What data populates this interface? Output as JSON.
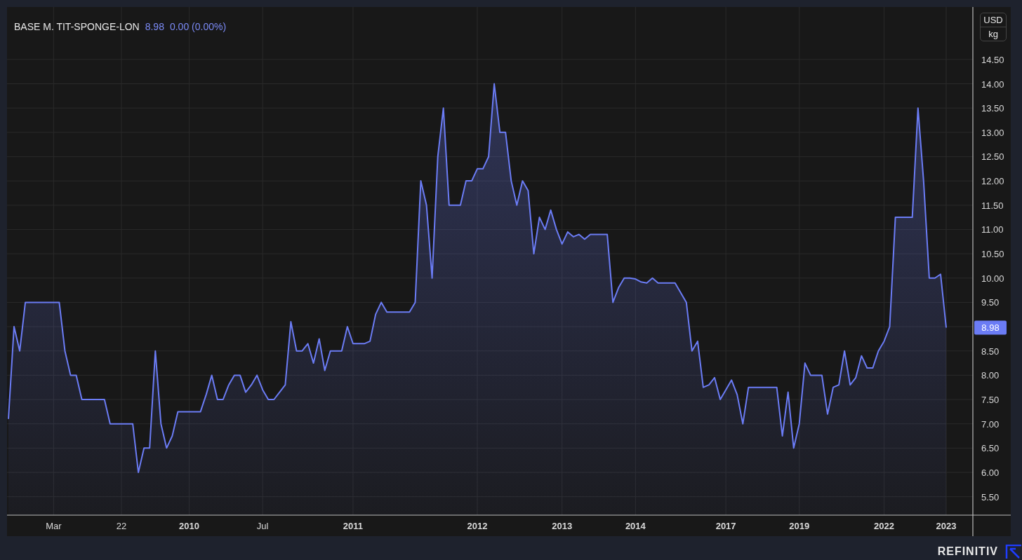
{
  "legend": {
    "last": "8.98",
    "change": "0.00 (0.00%)"
  },
  "units": [
    "USD",
    "kg"
  ],
  "chart": {
    "xtick_bold": [
      false,
      false,
      true,
      false,
      true,
      true,
      true,
      true,
      true,
      true,
      true,
      true
    ],
    "chart_data": {
      "type": "area",
      "grid": true,
      "ylim": [
        5.12,
        15.58
      ],
      "yticks": [
        {
          "value": 5.5,
          "label": "5.50"
        },
        {
          "value": 6,
          "label": "6.00"
        },
        {
          "value": 6.5,
          "label": "6.50"
        },
        {
          "value": 7,
          "label": "7.00"
        },
        {
          "value": 7.5,
          "label": "7.50"
        },
        {
          "value": 8,
          "label": "8.00"
        },
        {
          "value": 8.5,
          "label": "8.50"
        },
        {
          "value": 9.5,
          "label": "9.50"
        },
        {
          "value": 10,
          "label": "10.00"
        },
        {
          "value": 10.5,
          "label": "10.50"
        },
        {
          "value": 11,
          "label": "11.00"
        },
        {
          "value": 11.5,
          "label": "11.50"
        },
        {
          "value": 12,
          "label": "12.00"
        },
        {
          "value": 12.5,
          "label": "12.50"
        },
        {
          "value": 13,
          "label": "13.00"
        },
        {
          "value": 13.5,
          "label": "13.50"
        },
        {
          "value": 14,
          "label": "14.00"
        },
        {
          "value": 14.5,
          "label": "14.50"
        }
      ],
      "categories": [
        null,
        null,
        null,
        null,
        null,
        null,
        null,
        null,
        "Mar",
        null,
        null,
        null,
        null,
        null,
        null,
        null,
        null,
        null,
        null,
        null,
        "22",
        null,
        null,
        null,
        null,
        null,
        null,
        null,
        null,
        null,
        null,
        null,
        "2010",
        null,
        null,
        null,
        null,
        null,
        null,
        null,
        null,
        null,
        null,
        null,
        null,
        "Jul",
        null,
        null,
        null,
        null,
        null,
        null,
        null,
        null,
        null,
        null,
        null,
        null,
        null,
        null,
        null,
        "2011",
        null,
        null,
        null,
        null,
        null,
        null,
        null,
        null,
        null,
        null,
        null,
        null,
        null,
        null,
        null,
        null,
        null,
        null,
        null,
        null,
        null,
        "2012",
        null,
        null,
        null,
        null,
        null,
        null,
        null,
        null,
        null,
        null,
        null,
        null,
        null,
        null,
        "2013",
        null,
        null,
        null,
        null,
        null,
        null,
        null,
        null,
        null,
        null,
        null,
        null,
        "2014",
        null,
        null,
        null,
        null,
        null,
        null,
        null,
        null,
        null,
        null,
        null,
        null,
        null,
        null,
        null,
        "2017",
        null,
        null,
        null,
        null,
        null,
        null,
        null,
        null,
        null,
        null,
        null,
        null,
        "2019",
        null,
        null,
        null,
        null,
        null,
        null,
        null,
        null,
        null,
        null,
        null,
        null,
        null,
        null,
        "2022",
        null,
        null,
        null,
        null,
        null,
        null,
        null,
        null,
        null,
        null,
        "2023"
      ],
      "series": [
        {
          "name": "BASE M. TIT-SPONGE-LON",
          "color": "#6b7cf5",
          "values": [
            7.1,
            9.0,
            8.5,
            9.5,
            9.5,
            9.5,
            9.5,
            9.5,
            9.5,
            9.5,
            8.5,
            8.0,
            8.0,
            7.5,
            7.5,
            7.5,
            7.5,
            7.5,
            7.0,
            7.0,
            7.0,
            7.0,
            7.0,
            6.0,
            6.5,
            6.5,
            8.5,
            7.0,
            6.5,
            6.75,
            7.25,
            7.25,
            7.25,
            7.25,
            7.25,
            7.6,
            8.0,
            7.5,
            7.5,
            7.8,
            8.0,
            8.0,
            7.65,
            7.8,
            8.0,
            7.7,
            7.5,
            7.5,
            7.65,
            7.8,
            9.1,
            8.5,
            8.5,
            8.65,
            8.25,
            8.75,
            8.1,
            8.5,
            8.5,
            8.5,
            9.0,
            8.65,
            8.65,
            8.65,
            8.7,
            9.25,
            9.5,
            9.3,
            9.3,
            9.3,
            9.3,
            9.3,
            9.5,
            12.0,
            11.5,
            10.0,
            12.5,
            13.5,
            11.5,
            11.5,
            11.5,
            12.0,
            12.0,
            12.25,
            12.25,
            12.5,
            14.0,
            13.0,
            13.0,
            12.0,
            11.5,
            12.0,
            11.8,
            10.5,
            11.25,
            11.0,
            11.4,
            11.0,
            10.7,
            10.95,
            10.85,
            10.9,
            10.8,
            10.9,
            10.9,
            10.9,
            10.9,
            9.5,
            9.8,
            10.0,
            10.0,
            9.98,
            9.92,
            9.9,
            10.0,
            9.9,
            9.9,
            9.9,
            9.9,
            9.7,
            9.5,
            8.5,
            8.7,
            7.75,
            7.8,
            7.95,
            7.5,
            7.7,
            7.9,
            7.6,
            7.0,
            7.75,
            7.75,
            7.75,
            7.75,
            7.75,
            7.75,
            6.75,
            7.65,
            6.5,
            7.0,
            8.25,
            8.0,
            8.0,
            8.0,
            7.2,
            7.75,
            7.8,
            8.5,
            7.8,
            7.95,
            8.4,
            8.15,
            8.15,
            8.5,
            8.7,
            9.0,
            11.25,
            11.25,
            11.25,
            11.25,
            13.5,
            12.0,
            10.0,
            10.0,
            10.08,
            8.98
          ]
        }
      ]
    },
    "price_tag": "8.98"
  },
  "logo": "REFINITIV"
}
